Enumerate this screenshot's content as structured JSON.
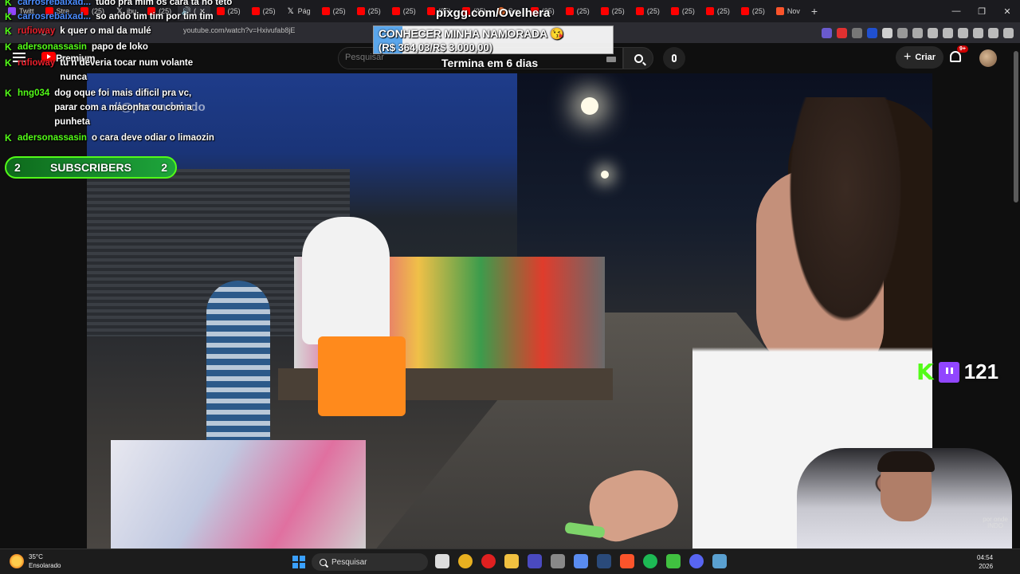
{
  "browser": {
    "tabs": [
      {
        "label": "Twitt",
        "icon": "twitch-icon"
      },
      {
        "label": "Stre",
        "icon": "youtube-icon"
      },
      {
        "label": "(25)",
        "icon": "youtube-icon"
      },
      {
        "label": "jbu",
        "icon": "x-icon"
      },
      {
        "label": "(25)",
        "icon": "youtube-icon"
      },
      {
        "label": "(",
        "icon": "audio-icon",
        "active": true
      },
      {
        "label": "(25)",
        "icon": "youtube-icon"
      },
      {
        "label": "(25)",
        "icon": "youtube-icon"
      },
      {
        "label": "Pág",
        "icon": "x-icon"
      },
      {
        "label": "(25)",
        "icon": "youtube-icon"
      },
      {
        "label": "(25)",
        "icon": "youtube-icon"
      },
      {
        "label": "(25)",
        "icon": "youtube-icon"
      },
      {
        "label": "(25)",
        "icon": "youtube-icon"
      },
      {
        "label": "(25)",
        "icon": "youtube-icon"
      },
      {
        "label": "Sor",
        "icon": "sorare-icon"
      },
      {
        "label": "(25)",
        "icon": "youtube-icon"
      },
      {
        "label": "(25)",
        "icon": "youtube-icon"
      },
      {
        "label": "(25)",
        "icon": "youtube-icon"
      },
      {
        "label": "(25)",
        "icon": "youtube-icon"
      },
      {
        "label": "(25)",
        "icon": "youtube-icon"
      },
      {
        "label": "(25)",
        "icon": "youtube-icon"
      },
      {
        "label": "(25)",
        "icon": "youtube-icon"
      },
      {
        "label": "Nov",
        "icon": "brave-icon"
      }
    ],
    "new_tab": "+",
    "url": "youtube.com/watch?v=Hxivufab8jE",
    "window_controls": [
      "—",
      "❐",
      "✕"
    ]
  },
  "youtube": {
    "logo_text": "Premium",
    "search_placeholder": "Pesquisar",
    "create_label": "Criar",
    "notifications_badge": "9+"
  },
  "overlay": {
    "pix_url": "pixgg.com/Ovelhera",
    "goal_title": "CONHECER MINHA NAMORADA 😘",
    "goal_value": "(R$ 364,03/R$ 3.000,00)",
    "goal_progress": 0.121,
    "countdown": "Termina em 6 dias",
    "watermark": "//@porondeindo",
    "subscribers_left": "2",
    "subscribers_label": "SUBSCRIBERS",
    "subscribers_right": "2",
    "viewer_count": "121",
    "channel_logo": "por onde INDO"
  },
  "chat": [
    {
      "user": "carrosrebaixad...",
      "text": "tudo pra mim os cara ta no teto",
      "color": "blue"
    },
    {
      "user": "carrosrebaixad...",
      "text": "so ando tim tim por tim tim",
      "color": "blue"
    },
    {
      "user": "rufioway",
      "text": "k quer o mal da mulé",
      "color": "red"
    },
    {
      "user": "adersonassasin",
      "text": "papo de loko",
      "color": "green"
    },
    {
      "user": "rufioway",
      "text": "tu n deveria tocar num volante nunca",
      "color": "red"
    },
    {
      "user": "hng034",
      "text": "dog oque foi mais dificil pra vc, parar com a maconha ou com a punheta",
      "color": "green"
    },
    {
      "user": "adersonassasin",
      "text": "o cara deve odiar o limaozin",
      "color": "green"
    }
  ],
  "taskbar": {
    "temperature": "35°C",
    "weather": "Ensolarado",
    "search_label": "Pesquisar",
    "time": "04:54",
    "date": "2026",
    "apps": [
      "explorer-icon",
      "chrome-icon",
      "opera-icon",
      "files-icon",
      "app-icon",
      "github-icon",
      "arrow-app-icon",
      "steam-icon",
      "brave-icon",
      "spotify-icon",
      "terminal-icon",
      "discord-icon",
      "notepad-icon"
    ]
  }
}
